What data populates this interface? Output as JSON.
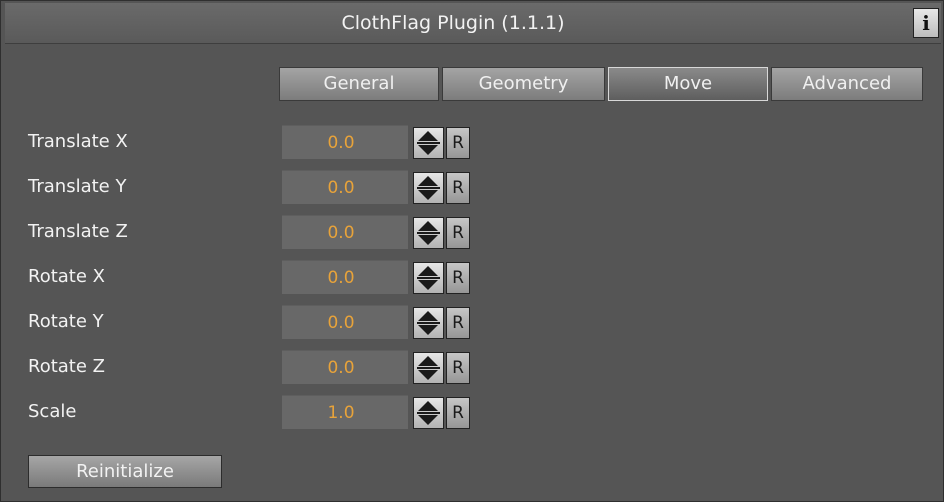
{
  "window": {
    "title": "ClothFlag Plugin (1.1.1)",
    "info_label": "i"
  },
  "tabs": [
    {
      "label": "General",
      "active": false
    },
    {
      "label": "Geometry",
      "active": false
    },
    {
      "label": "Move",
      "active": true
    },
    {
      "label": "Advanced",
      "active": false
    }
  ],
  "fields": [
    {
      "label": "Translate X",
      "value": "0.0",
      "reset_label": "R"
    },
    {
      "label": "Translate Y",
      "value": "0.0",
      "reset_label": "R"
    },
    {
      "label": "Translate Z",
      "value": "0.0",
      "reset_label": "R"
    },
    {
      "label": "Rotate X",
      "value": "0.0",
      "reset_label": "R"
    },
    {
      "label": "Rotate Y",
      "value": "0.0",
      "reset_label": "R"
    },
    {
      "label": "Rotate Z",
      "value": "0.0",
      "reset_label": "R"
    },
    {
      "label": "Scale",
      "value": "1.0",
      "reset_label": "R"
    }
  ],
  "reinitialize_label": "Reinitialize",
  "colors": {
    "value_text": "#e8a33a",
    "panel_bg": "#555555"
  },
  "icons": {
    "info": "info-icon",
    "spinner": "up-down-arrows-icon"
  }
}
